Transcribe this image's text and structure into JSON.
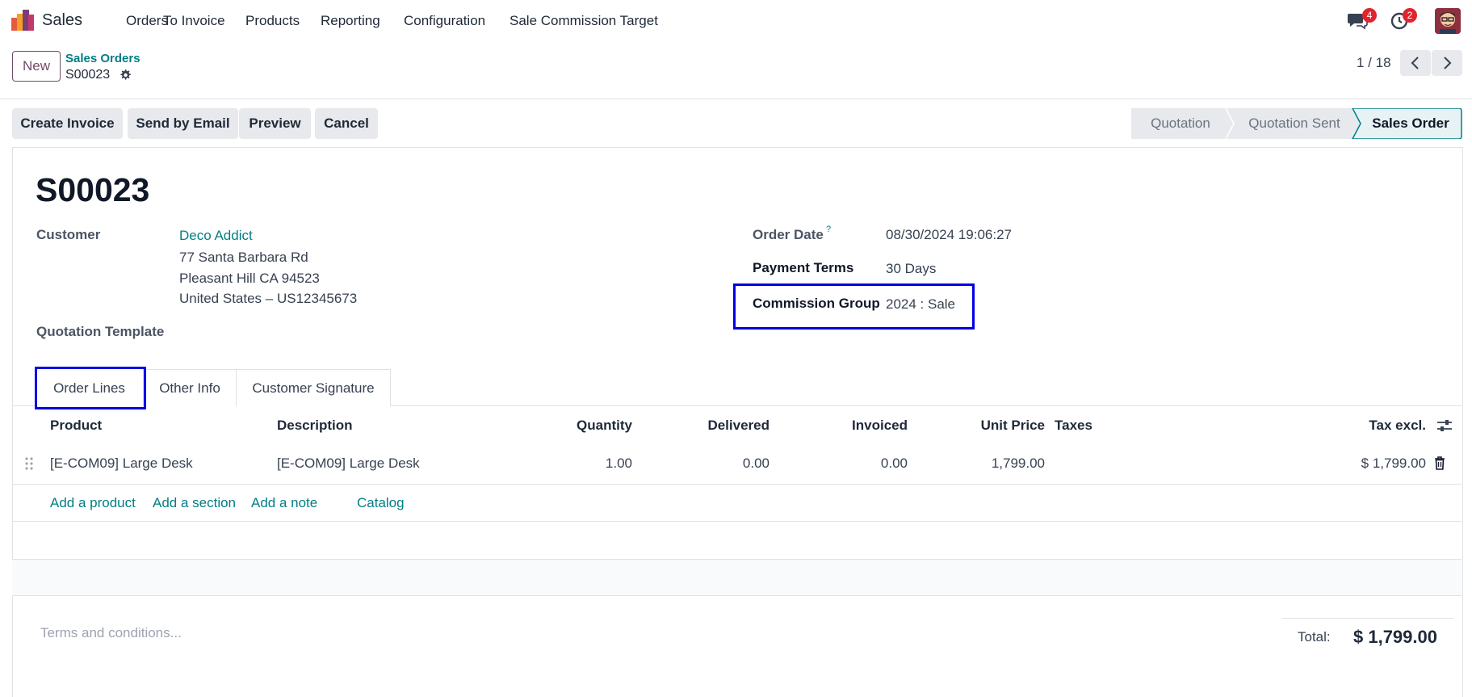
{
  "navbar": {
    "app_name": "Sales",
    "menu": [
      "Orders",
      "To Invoice",
      "Products",
      "Reporting",
      "Configuration",
      "Sale Commission Target"
    ],
    "messages_count": "4",
    "activities_count": "2"
  },
  "control_panel": {
    "new_label": "New",
    "breadcrumb": "Sales Orders",
    "record_name": "S00023",
    "pager": "1 / 18"
  },
  "actions": [
    "Create Invoice",
    "Send by Email",
    "Preview",
    "Cancel"
  ],
  "statusbar": {
    "stages": [
      "Quotation",
      "Quotation Sent",
      "Sales Order"
    ],
    "active": "Sales Order"
  },
  "form": {
    "title": "S00023",
    "customer_label": "Customer",
    "customer_name": "Deco Addict",
    "address_line1": "77 Santa Barbara Rd",
    "address_line2": "Pleasant Hill CA 94523",
    "address_line3": "United States – US12345673",
    "quotation_template_label": "Quotation Template",
    "order_date_label": "Order Date",
    "order_date_help": "?",
    "order_date": "08/30/2024 19:06:27",
    "payment_terms_label": "Payment Terms",
    "payment_terms": "30 Days",
    "commission_group_label": "Commission Group",
    "commission_group": "2024 : Sale"
  },
  "tabs": [
    "Order Lines",
    "Other Info",
    "Customer Signature"
  ],
  "table": {
    "headers": {
      "product": "Product",
      "description": "Description",
      "quantity": "Quantity",
      "delivered": "Delivered",
      "invoiced": "Invoiced",
      "unit_price": "Unit Price",
      "taxes": "Taxes",
      "tax_excl": "Tax excl."
    },
    "row": {
      "product": "[E-COM09] Large Desk",
      "description": "[E-COM09] Large Desk",
      "quantity": "1.00",
      "delivered": "0.00",
      "invoiced": "0.00",
      "unit_price": "1,799.00",
      "taxes": "",
      "subtotal": "$ 1,799.00"
    },
    "add_links": [
      "Add a product",
      "Add a section",
      "Add a note",
      "Catalog"
    ]
  },
  "footer": {
    "terms_placeholder": "Terms and conditions...",
    "total_label": "Total:",
    "total_value": "$ 1,799.00"
  },
  "colors": {
    "brand": "#714b67",
    "link": "#017e84",
    "highlight": "#0000e6",
    "badge": "#e0242e"
  }
}
